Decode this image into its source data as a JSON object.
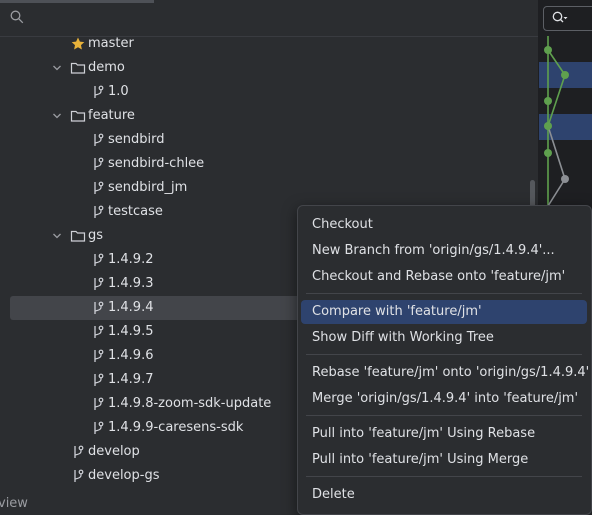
{
  "tree": {
    "rows": [
      {
        "label": "master",
        "icon": "star-icon",
        "starred": true
      },
      {
        "label": "demo",
        "icon": "folder-icon",
        "expanded": true
      },
      {
        "label": "1.0",
        "icon": "branch-icon"
      },
      {
        "label": "feature",
        "icon": "folder-icon",
        "expanded": true
      },
      {
        "label": "sendbird",
        "icon": "branch-icon"
      },
      {
        "label": "sendbird-chlee",
        "icon": "branch-icon"
      },
      {
        "label": "sendbird_jm",
        "icon": "branch-icon"
      },
      {
        "label": "testcase",
        "icon": "branch-icon"
      },
      {
        "label": "gs",
        "icon": "folder-icon",
        "expanded": true
      },
      {
        "label": "1.4.9.2",
        "icon": "branch-icon"
      },
      {
        "label": "1.4.9.3",
        "icon": "branch-icon"
      },
      {
        "label": "1.4.9.4",
        "icon": "branch-icon",
        "selected": true
      },
      {
        "label": "1.4.9.5",
        "icon": "branch-icon"
      },
      {
        "label": "1.4.9.6",
        "icon": "branch-icon"
      },
      {
        "label": "1.4.9.7",
        "icon": "branch-icon"
      },
      {
        "label": "1.4.9.8-zoom-sdk-update",
        "icon": "branch-icon"
      },
      {
        "label": "1.4.9.9-caresens-sdk",
        "icon": "branch-icon"
      },
      {
        "label": "develop",
        "icon": "branch-icon"
      },
      {
        "label": "develop-gs",
        "icon": "branch-icon"
      }
    ]
  },
  "bottom_label": "view",
  "context_menu": {
    "items": [
      {
        "label": "Checkout"
      },
      {
        "label": "New Branch from 'origin/gs/1.4.9.4'..."
      },
      {
        "label": "Checkout and Rebase onto 'feature/jm'"
      },
      {
        "label": "Compare with 'feature/jm'",
        "highlighted": true
      },
      {
        "label": "Show Diff with Working Tree"
      },
      {
        "label": "Rebase 'feature/jm' onto 'origin/gs/1.4.9.4'"
      },
      {
        "label": "Merge 'origin/gs/1.4.9.4' into 'feature/jm'"
      },
      {
        "label": "Pull into 'feature/jm' Using Rebase"
      },
      {
        "label": "Pull into 'feature/jm' Using Merge"
      },
      {
        "label": "Delete"
      }
    ]
  },
  "colors": {
    "background": "#2b2d30",
    "selection": "#43454a",
    "menu_highlight": "#2e436e",
    "graph_green": "#5fa04e",
    "graph_gray": "#8c8f94",
    "star": "#e8b23a"
  }
}
